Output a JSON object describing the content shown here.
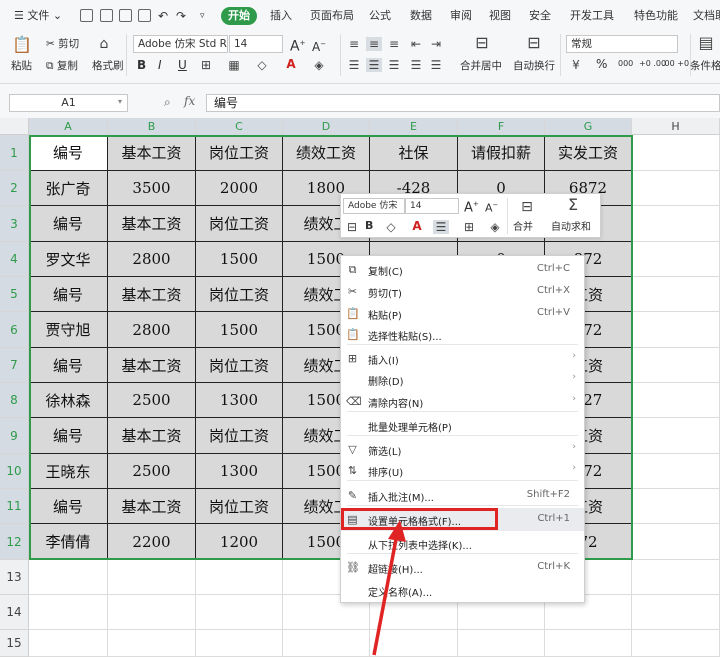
{
  "app": {
    "menu_label": "文件",
    "tabs": [
      "开始",
      "插入",
      "页面布局",
      "公式",
      "数据",
      "审阅",
      "视图",
      "安全",
      "开发工具",
      "特色功能",
      "文档助"
    ],
    "active_tab": "开始"
  },
  "ribbon": {
    "paste": "粘贴",
    "cut": "剪切",
    "copy": "复制",
    "format_painter": "格式刷",
    "font_name": "Adobe 仿宋 Std R",
    "font_size": "14",
    "bold": "B",
    "italic": "I",
    "underline": "U",
    "merge": "合并居中",
    "wrap": "自动换行",
    "number_format": "常规",
    "percent": "%",
    "thousands": "000",
    "dec_inc": "+0 .00",
    "dec_dec": ".00 +0",
    "cond_format": "条件格",
    "font_grow": "A",
    "font_shrink": "A"
  },
  "formula_bar": {
    "cell_ref": "A1",
    "fx": "fx",
    "content": "编号"
  },
  "columns": [
    "A",
    "B",
    "C",
    "D",
    "E",
    "F",
    "G",
    "H"
  ],
  "rows": [
    "1",
    "2",
    "3",
    "4",
    "5",
    "6",
    "7",
    "8",
    "9",
    "10",
    "11",
    "12",
    "13",
    "14",
    "15"
  ],
  "table": [
    [
      "编号",
      "基本工资",
      "岗位工资",
      "绩效工资",
      "社保",
      "请假扣薪",
      "实发工资"
    ],
    [
      "张广奇",
      "3500",
      "2000",
      "1800",
      "-428",
      "0",
      "6872"
    ],
    [
      "编号",
      "基本工资",
      "岗位工资",
      "绩效工",
      "",
      "",
      "资"
    ],
    [
      "罗文华",
      "2800",
      "1500",
      "1500",
      "",
      "0",
      "872"
    ],
    [
      "编号",
      "基本工资",
      "岗位工资",
      "绩效工",
      "",
      "",
      "工资"
    ],
    [
      "贾守旭",
      "2800",
      "1500",
      "1500",
      "",
      "",
      "372"
    ],
    [
      "编号",
      "基本工资",
      "岗位工资",
      "绩效工",
      "",
      "",
      "工资"
    ],
    [
      "徐林森",
      "2500",
      "1300",
      "1500",
      "",
      "",
      "627"
    ],
    [
      "编号",
      "基本工资",
      "岗位工资",
      "绩效工",
      "",
      "",
      "工资"
    ],
    [
      "王晓东",
      "2500",
      "1300",
      "1500",
      "",
      "",
      "372"
    ],
    [
      "编号",
      "基本工资",
      "岗位工资",
      "绩效工",
      "",
      "",
      "工资"
    ],
    [
      "李倩倩",
      "2200",
      "1200",
      "1500",
      "",
      "",
      "72"
    ]
  ],
  "mini_toolbar": {
    "font": "Adobe 仿宋",
    "size": "14",
    "bold": "B",
    "merge": "合并",
    "autosum": "自动求和"
  },
  "context_menu": [
    {
      "label": "复制(C)",
      "key": "Ctrl+C",
      "icon": "copy-icon"
    },
    {
      "label": "剪切(T)",
      "key": "Ctrl+X",
      "icon": "scissors-icon"
    },
    {
      "label": "粘贴(P)",
      "key": "Ctrl+V",
      "icon": "paste-icon"
    },
    {
      "label": "选择性粘贴(S)...",
      "key": "",
      "icon": "paste-special-icon"
    },
    {
      "label": "插入(I)",
      "key": "",
      "icon": "insert-icon",
      "sub": true
    },
    {
      "label": "删除(D)",
      "key": "",
      "icon": "",
      "sub": true
    },
    {
      "label": "清除内容(N)",
      "key": "",
      "icon": "eraser-icon",
      "sub": true
    },
    {
      "label": "批量处理单元格(P)",
      "key": "",
      "icon": ""
    },
    {
      "label": "筛选(L)",
      "key": "",
      "icon": "filter-icon",
      "sub": true
    },
    {
      "label": "排序(U)",
      "key": "",
      "icon": "sort-icon",
      "sub": true
    },
    {
      "label": "插入批注(M)...",
      "key": "Shift+F2",
      "icon": "comment-icon"
    },
    {
      "label": "设置单元格格式(F)...",
      "key": "Ctrl+1",
      "icon": "format-cells-icon"
    },
    {
      "label": "从下拉列表中选择(K)...",
      "key": "",
      "icon": ""
    },
    {
      "label": "超链接(H)...",
      "key": "Ctrl+K",
      "icon": "link-icon"
    },
    {
      "label": "定义名称(A)...",
      "key": "",
      "icon": ""
    }
  ],
  "colors": {
    "accent": "#2f9b4a",
    "highlight": "#e02424",
    "cell_fill": "#d9d9d9"
  }
}
